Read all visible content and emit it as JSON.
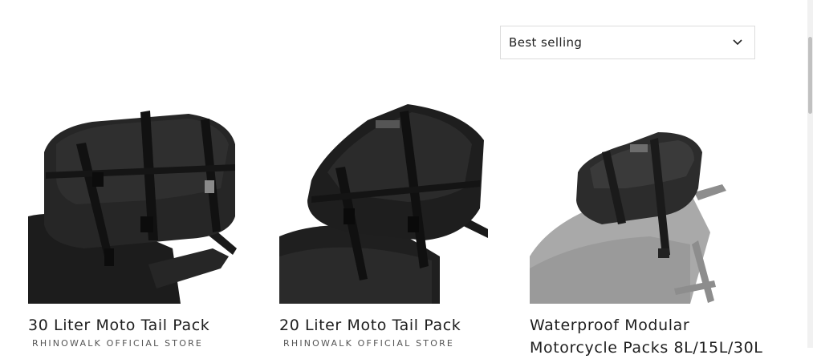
{
  "sort": {
    "selected": "Best selling"
  },
  "products": [
    {
      "title": "30 Liter Moto Tail Pack",
      "vendor": "RHINOWALK OFFICIAL STORE",
      "image_icon": "tail-pack-30l-image"
    },
    {
      "title": "20 Liter Moto Tail Pack",
      "vendor": "RHINOWALK OFFICIAL STORE",
      "image_icon": "tail-pack-20l-image"
    },
    {
      "title": "Waterproof Modular",
      "title_line2": "Motorcycle Packs 8L/15L/30L",
      "image_icon": "modular-pack-image"
    }
  ]
}
